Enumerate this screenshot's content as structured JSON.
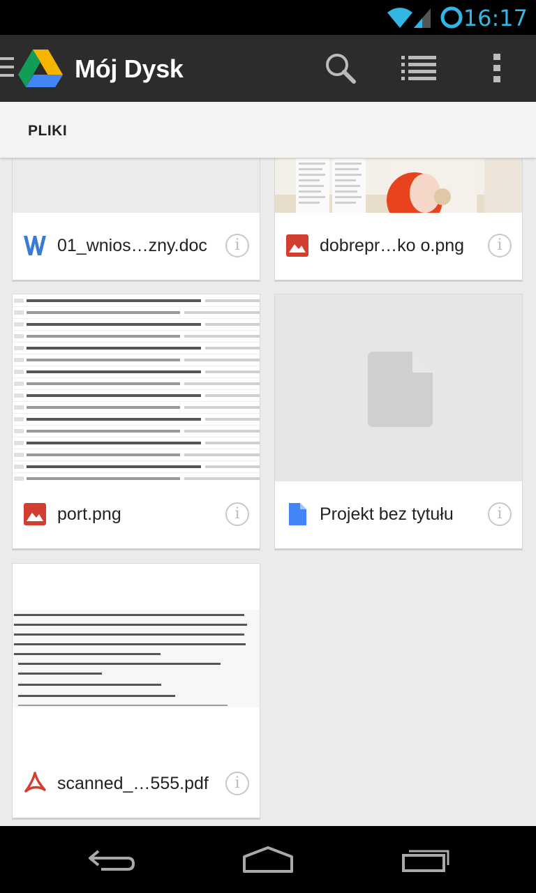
{
  "status_bar": {
    "time": "16:17"
  },
  "action_bar": {
    "title": "Mój Dysk"
  },
  "section": {
    "title": "PLIKI"
  },
  "files": [
    {
      "name": "01_wnios…zny.doc",
      "type": "word-doc",
      "icon": "word-icon"
    },
    {
      "name": "dobrepr…ko o.png",
      "type": "image",
      "icon": "image-icon"
    },
    {
      "name": "port.png",
      "type": "image",
      "icon": "image-icon"
    },
    {
      "name": "Projekt bez tytułu",
      "type": "document",
      "icon": "document-icon"
    },
    {
      "name": "scanned_…555.pdf",
      "type": "pdf",
      "icon": "pdf-icon"
    }
  ],
  "colors": {
    "accent": "#33b5e5",
    "action_bar": "#2c2c2c",
    "image_icon": "#d23f31",
    "doc_icon": "#4285f4",
    "word_icon": "#3a7bd5"
  }
}
